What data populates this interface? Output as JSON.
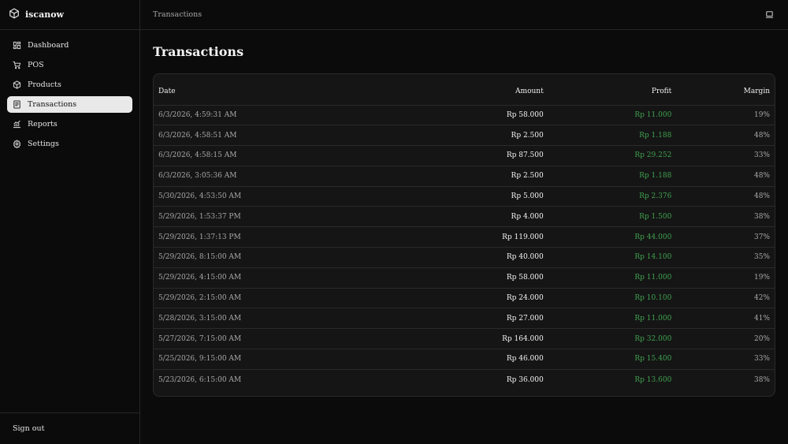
{
  "brand": {
    "name": "iscanow",
    "icon": "box-icon"
  },
  "nav": [
    {
      "label": "Dashboard",
      "icon": "grid-icon"
    },
    {
      "label": "POS",
      "icon": "cart-icon"
    },
    {
      "label": "Products",
      "icon": "box-icon"
    },
    {
      "label": "Transactions",
      "icon": "receipt-icon",
      "active": true
    },
    {
      "label": "Reports",
      "icon": "chart-icon"
    },
    {
      "label": "Settings",
      "icon": "gear-icon"
    }
  ],
  "footer": {
    "signout_label": "Sign out"
  },
  "topbar": {
    "breadcrumb": "Transactions",
    "action_icon": "laptop-icon"
  },
  "page": {
    "title": "Transactions"
  },
  "table": {
    "columns": {
      "date": "Date",
      "amount": "Amount",
      "profit": "Profit",
      "margin": "Margin"
    },
    "rows": [
      {
        "date": "6/3/2026, 4:59:31 AM",
        "amount": "Rp 58.000",
        "profit": "Rp 11.000",
        "margin": "19%"
      },
      {
        "date": "6/3/2026, 4:58:51 AM",
        "amount": "Rp 2.500",
        "profit": "Rp 1.188",
        "margin": "48%"
      },
      {
        "date": "6/3/2026, 4:58:15 AM",
        "amount": "Rp 87.500",
        "profit": "Rp 29.252",
        "margin": "33%"
      },
      {
        "date": "6/3/2026, 3:05:36 AM",
        "amount": "Rp 2.500",
        "profit": "Rp 1.188",
        "margin": "48%"
      },
      {
        "date": "5/30/2026, 4:53:50 AM",
        "amount": "Rp 5.000",
        "profit": "Rp 2.376",
        "margin": "48%"
      },
      {
        "date": "5/29/2026, 1:53:37 PM",
        "amount": "Rp 4.000",
        "profit": "Rp 1.500",
        "margin": "38%"
      },
      {
        "date": "5/29/2026, 1:37:13 PM",
        "amount": "Rp 119.000",
        "profit": "Rp 44.000",
        "margin": "37%"
      },
      {
        "date": "5/29/2026, 8:15:00 AM",
        "amount": "Rp 40.000",
        "profit": "Rp 14.100",
        "margin": "35%"
      },
      {
        "date": "5/29/2026, 4:15:00 AM",
        "amount": "Rp 58.000",
        "profit": "Rp 11.000",
        "margin": "19%"
      },
      {
        "date": "5/29/2026, 2:15:00 AM",
        "amount": "Rp 24.000",
        "profit": "Rp 10.100",
        "margin": "42%"
      },
      {
        "date": "5/28/2026, 3:15:00 AM",
        "amount": "Rp 27.000",
        "profit": "Rp 11.000",
        "margin": "41%"
      },
      {
        "date": "5/27/2026, 7:15:00 AM",
        "amount": "Rp 164.000",
        "profit": "Rp 32.000",
        "margin": "20%"
      },
      {
        "date": "5/25/2026, 9:15:00 AM",
        "amount": "Rp 46.000",
        "profit": "Rp 15.400",
        "margin": "33%"
      },
      {
        "date": "5/23/2026, 6:15:00 AM",
        "amount": "Rp 36.000",
        "profit": "Rp 13.600",
        "margin": "38%"
      }
    ]
  },
  "colors": {
    "background": "#0b0b0b",
    "card": "#151515",
    "profit": "#3fa14f",
    "active_nav_bg": "#e9e9e9"
  }
}
